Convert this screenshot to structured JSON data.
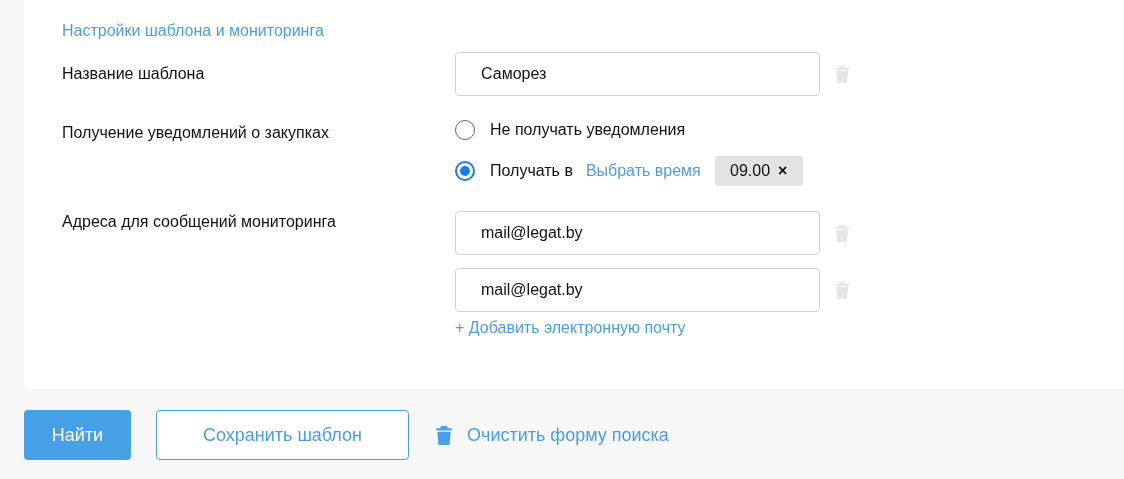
{
  "section_title": "Настройки шаблона и мониторинга",
  "template_name": {
    "label": "Название шаблона",
    "value": "Саморез"
  },
  "notifications": {
    "label": "Получение уведомлений о закупках",
    "options": [
      {
        "label": "Не получать уведомления",
        "selected": false
      },
      {
        "label": "Получать в",
        "selected": true,
        "link": "Выбрать время",
        "time": "09.00",
        "remove": "×"
      }
    ]
  },
  "addresses": {
    "label": "Адреса для сообщений мониторинга",
    "emails": [
      "mail@legat.by",
      "mail@legat.by"
    ],
    "add_link": "+ Добавить электронную почту"
  },
  "buttons": {
    "find": "Найти",
    "save": "Сохранить шаблон",
    "clear": "Очистить форму поиска"
  }
}
